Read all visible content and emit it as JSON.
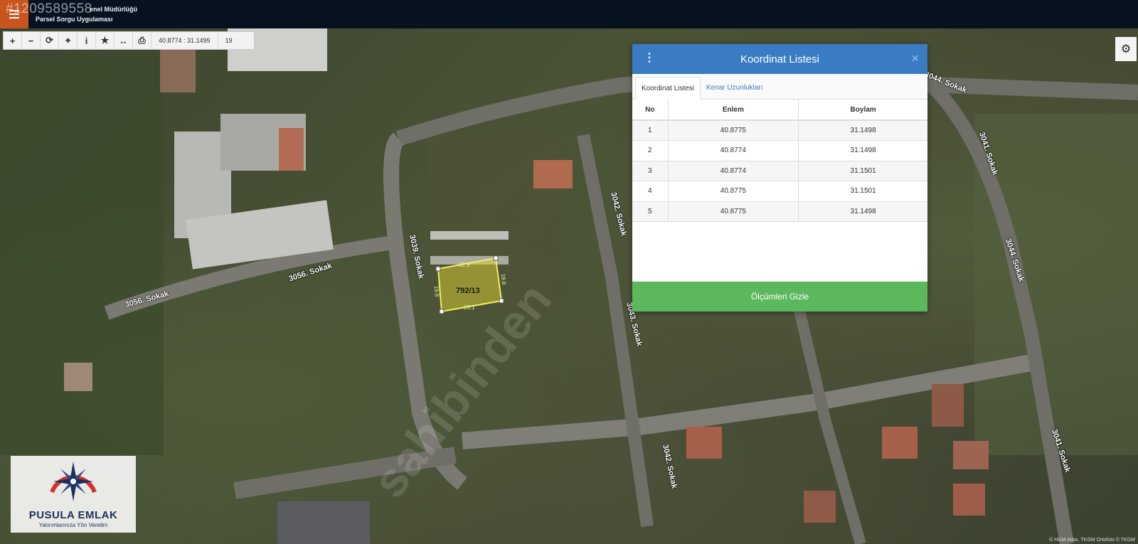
{
  "header": {
    "listing_id": "#1209589558",
    "line1": "enel Müdürlüğü",
    "line2": "Parsel Sorgu Uygulaması"
  },
  "toolbar": {
    "tools": [
      {
        "name": "zoom-in-button",
        "icon": "plus-icon",
        "glyph": "+"
      },
      {
        "name": "zoom-out-button",
        "icon": "minus-icon",
        "glyph": "−"
      },
      {
        "name": "refresh-button",
        "icon": "refresh-icon",
        "glyph": "⟳"
      },
      {
        "name": "locate-button",
        "icon": "crosshair-icon",
        "glyph": "⌖"
      },
      {
        "name": "info-button",
        "icon": "info-icon",
        "glyph": "i"
      },
      {
        "name": "favorite-button",
        "icon": "star-icon",
        "glyph": "★"
      },
      {
        "name": "measure-button",
        "icon": "ruler-arrows-icon",
        "glyph": "↔"
      },
      {
        "name": "print-button",
        "icon": "printer-icon",
        "glyph": "⎙"
      }
    ],
    "coordinates": "40.8774 : 31.1499",
    "zoom": "19"
  },
  "panel": {
    "title": "Koordinat Listesi",
    "tabs": [
      "Koordinat Listesi",
      "Kenar Uzunlukları"
    ],
    "columns": [
      "No",
      "Enlem",
      "Boylam"
    ],
    "rows": [
      [
        "1",
        "40.8775",
        "31.1498"
      ],
      [
        "2",
        "40.8774",
        "31.1498"
      ],
      [
        "3",
        "40.8774",
        "31.1501"
      ],
      [
        "4",
        "40.8775",
        "31.1501"
      ],
      [
        "5",
        "40.8775",
        "31.1498"
      ]
    ],
    "footer_button": "Ölçümleri Gizle",
    "close_glyph": "×"
  },
  "map": {
    "parcel": "792/13",
    "edges": [
      "22.9",
      "19.8",
      "23.1",
      "19.8"
    ],
    "streets": [
      "3044. Sokak",
      "3041. Sokak",
      "3044. Sokak",
      "3042. Sokak",
      "3039. Sokak",
      "3056. Sokak",
      "3056. Sokak",
      "3043. Sokak",
      "3041. Sokak",
      "3042. Sokak"
    ],
    "watermark": "sahibinden",
    "attribution": "© HGM Atlas, TKGM Ortofoto © TKGM"
  },
  "logo": {
    "name": "PUSULA EMLAK",
    "tagline": "Yatırımlarınıza Yön Verelim"
  },
  "colors": {
    "header_bg": "#06131f",
    "menu_accent": "#c9541e",
    "panel_header": "#3a7cc3",
    "footer_button": "#5cb85c"
  }
}
